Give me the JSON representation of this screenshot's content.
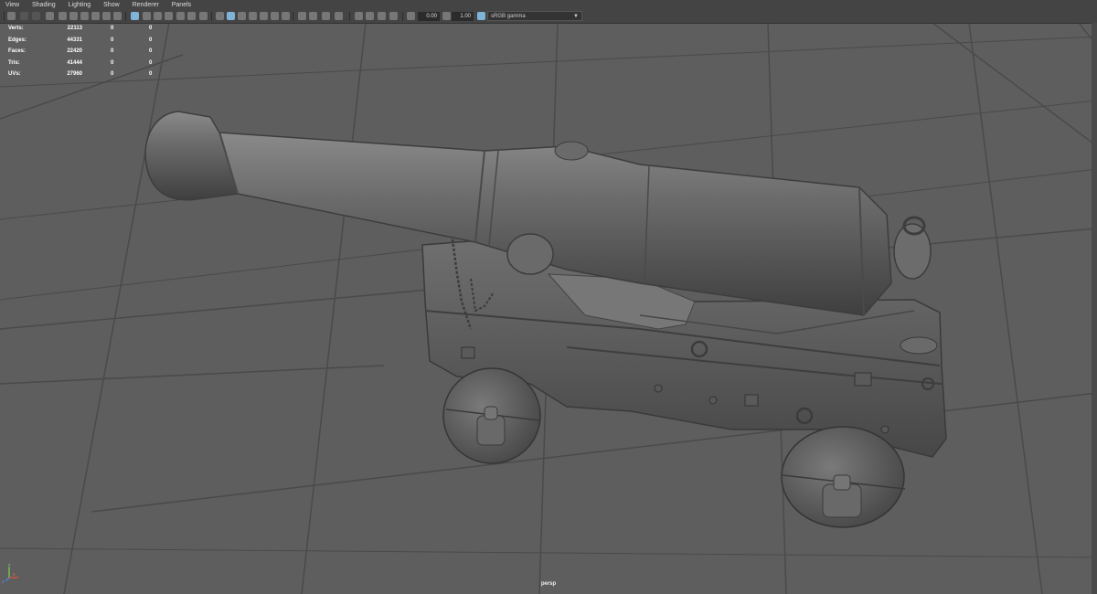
{
  "menu": [
    "View",
    "Shading",
    "Lighting",
    "Show",
    "Renderer",
    "Panels"
  ],
  "toolbar": {
    "exposure": "0.00",
    "gamma_value": "1.00",
    "color_space": "sRGB gamma"
  },
  "hud": [
    {
      "label": "Verts:",
      "v1": "22113",
      "v2": "0",
      "v3": "0"
    },
    {
      "label": "Edges:",
      "v1": "44331",
      "v2": "0",
      "v3": "0"
    },
    {
      "label": "Faces:",
      "v1": "22420",
      "v2": "0",
      "v3": "0"
    },
    {
      "label": "Tris:",
      "v1": "41444",
      "v2": "0",
      "v3": "0"
    },
    {
      "label": "UVs:",
      "v1": "27960",
      "v2": "0",
      "v3": "0"
    }
  ],
  "camera": "persp",
  "axis": {
    "x": "x",
    "y": "y",
    "z": "z"
  },
  "colors": {
    "viewport_bg": "#5e5e5e",
    "grid": "#494949",
    "model": "#6a6a6a",
    "toolbar_bg": "#444444",
    "active_icon": "#7fb4d8"
  }
}
